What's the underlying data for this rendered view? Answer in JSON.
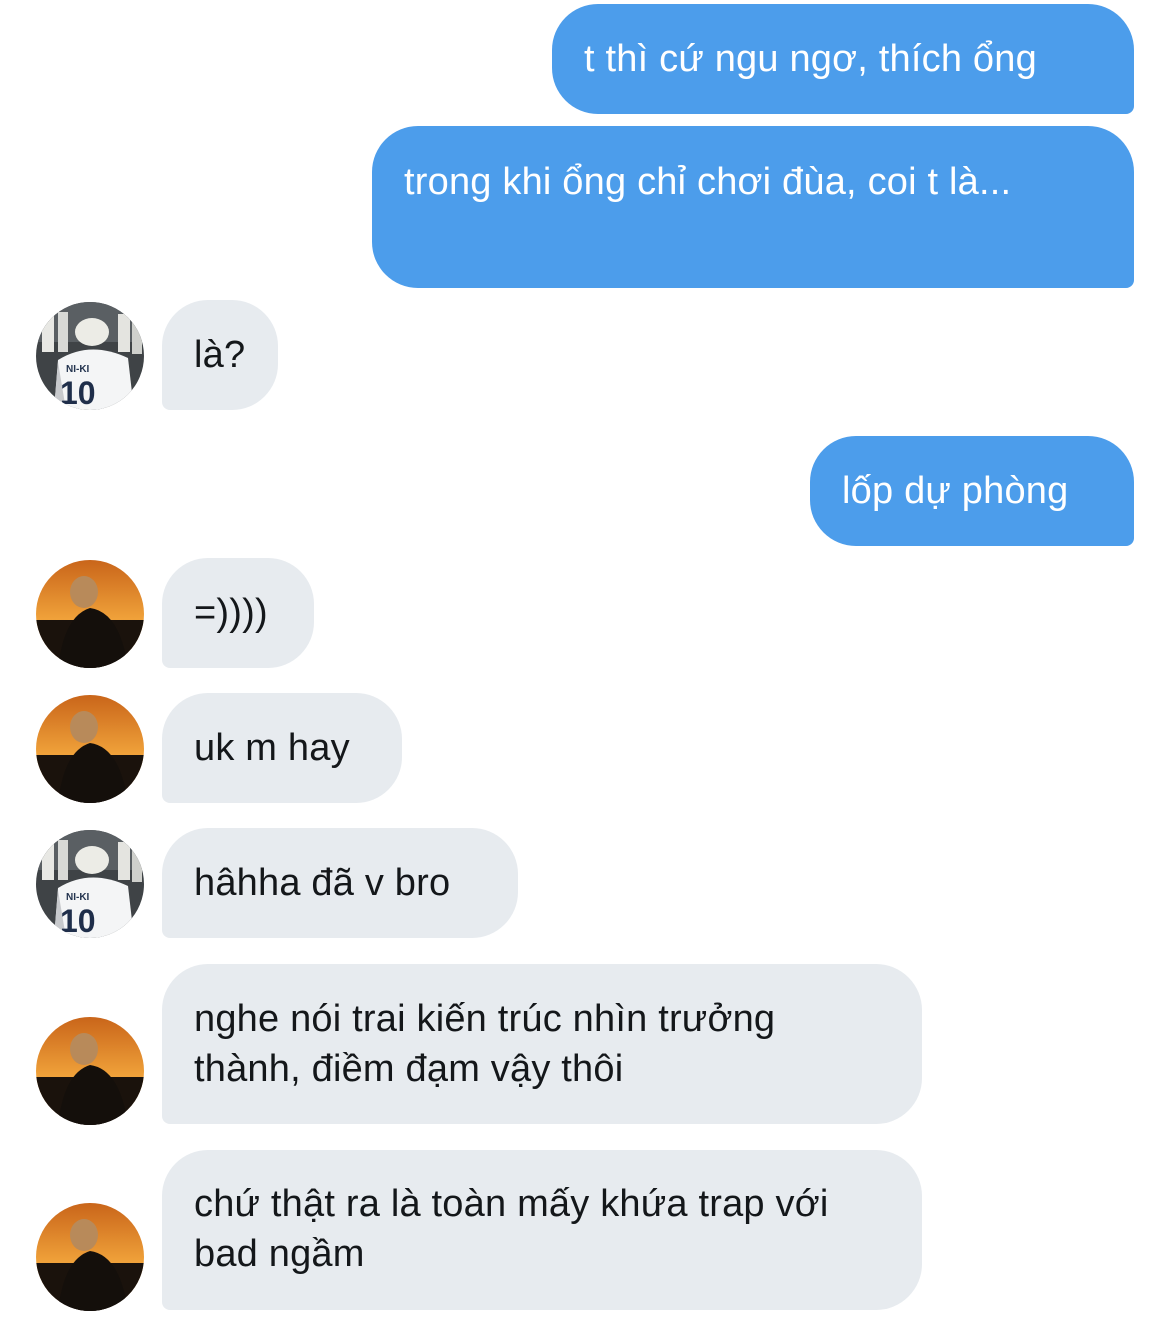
{
  "conversation": {
    "messages": [
      {
        "sender": "me",
        "text": "t thì cứ ngu ngơ, thích ổng"
      },
      {
        "sender": "me",
        "text": "trong khi ổng chỉ chơi đùa, coi t là..."
      },
      {
        "sender": "other",
        "avatar": "jersey-avatar",
        "text": "là?"
      },
      {
        "sender": "me",
        "text": "lốp dự phòng"
      },
      {
        "sender": "other",
        "avatar": "sunset-avatar",
        "text": "=))))"
      },
      {
        "sender": "other",
        "avatar": "sunset-avatar",
        "text": "uk m hay"
      },
      {
        "sender": "other",
        "avatar": "jersey-avatar",
        "text": "hâhha đã v bro"
      },
      {
        "sender": "other",
        "avatar": "sunset-avatar",
        "text": "nghe nói trai kiến trúc nhìn trưởng thành, điềm đạm vậy thôi"
      },
      {
        "sender": "other",
        "avatar": "sunset-avatar",
        "text": "chứ thật ra là toàn mấy khứa trap với bad ngầm"
      }
    ],
    "jersey": {
      "name": "NI-KI",
      "number": "10"
    }
  },
  "colors": {
    "sent_bubble": "#4c9deb",
    "received_bubble": "#e7ebef",
    "sent_text": "#ffffff",
    "received_text": "#14171a"
  }
}
